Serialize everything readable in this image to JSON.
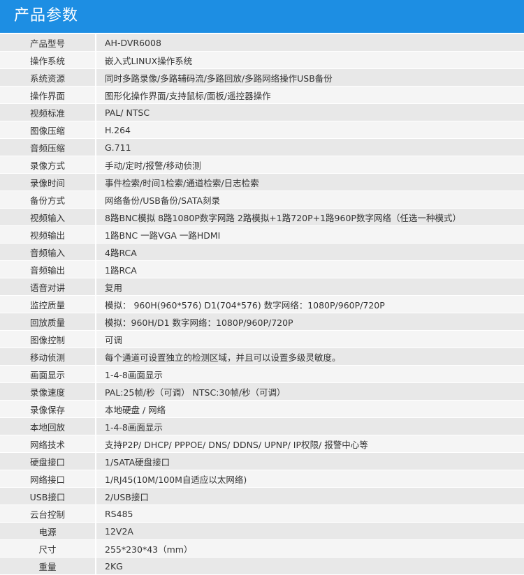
{
  "header": {
    "title": "产品参数"
  },
  "specs": [
    {
      "label": "产品型号",
      "value": "AH-DVR6008"
    },
    {
      "label": "操作系统",
      "value": "嵌入式LINUX操作系统"
    },
    {
      "label": "系统资源",
      "value": "同时多路录像/多路辅码流/多路回放/多路网络操作USB备份"
    },
    {
      "label": "操作界面",
      "value": "图形化操作界面/支持鼠标/面板/遥控器操作"
    },
    {
      "label": "视频标准",
      "value": "PAL/ NTSC"
    },
    {
      "label": "图像压缩",
      "value": "H.264"
    },
    {
      "label": "音频压缩",
      "value": "G.711"
    },
    {
      "label": "录像方式",
      "value": "手动/定时/报警/移动侦测"
    },
    {
      "label": "录像时间",
      "value": "事件检索/时间1检索/通道检索/日志检索"
    },
    {
      "label": "备份方式",
      "value": "网络备份/USB备份/SATA刻录"
    },
    {
      "label": "视频输入",
      "value": "8路BNC模拟  8路1080P数字网路  2路模拟+1路720P+1路960P数字网络（任选一种模式）"
    },
    {
      "label": "视频输出",
      "value": "1路BNC  一路VGA 一路HDMI"
    },
    {
      "label": "音频输入",
      "value": "4路RCA"
    },
    {
      "label": "音频输出",
      "value": "1路RCA"
    },
    {
      "label": "语音对讲",
      "value": "复用"
    },
    {
      "label": "监控质量",
      "value": "模拟： 960H(960*576)  D1(704*576)   数字网络：1080P/960P/720P"
    },
    {
      "label": "回放质量",
      "value": "模拟：960H/D1  数字网络：1080P/960P/720P"
    },
    {
      "label": "图像控制",
      "value": "可调"
    },
    {
      "label": "移动侦测",
      "value": "每个通道可设置独立的检测区域，并且可以设置多级灵敏度。"
    },
    {
      "label": "画面显示",
      "value": "1-4-8画面显示"
    },
    {
      "label": "录像速度",
      "value": "PAL:25帧/秒（可调）   NTSC:30帧/秒（可调）"
    },
    {
      "label": "录像保存",
      "value": "本地硬盘 / 网络"
    },
    {
      "label": "本地回放",
      "value": "1-4-8画面显示"
    },
    {
      "label": "网络技术",
      "value": "支持P2P/ DHCP/ PPPOE/ DNS/ DDNS/ UPNP/ IP权限/ 报警中心等"
    },
    {
      "label": "硬盘接口",
      "value": "1/SATA硬盘接口"
    },
    {
      "label": "网络接口",
      "value": "1/RJ45(10M/100M自适应以太网络)"
    },
    {
      "label": "USB接口",
      "value": "2/USB接口"
    },
    {
      "label": "云台控制",
      "value": "RS485"
    },
    {
      "label": "电源",
      "value": "12V2A"
    },
    {
      "label": "尺寸",
      "value": "255*230*43（mm）"
    },
    {
      "label": "重量",
      "value": "2KG"
    }
  ],
  "colors": {
    "header_bg": "#1d8ee3",
    "row_odd": "#e8e8e8",
    "row_even": "#f5f5f5",
    "text": "#333333"
  }
}
